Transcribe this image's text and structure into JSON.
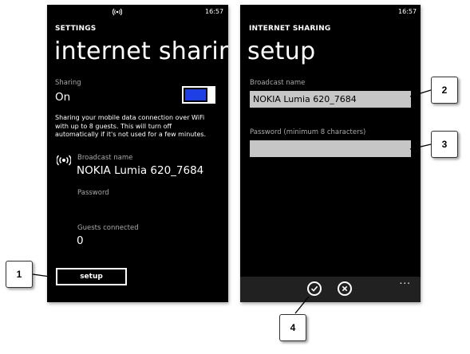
{
  "left_screen": {
    "status_time": "16:57",
    "app_title": "SETTINGS",
    "page_title": "internet sharing",
    "sharing_label": "Sharing",
    "sharing_value": "On",
    "toggle_on": true,
    "description": "Sharing your mobile data connection over WiFi with up to 8 guests. This will turn off automatically if it's not used for a few minutes.",
    "broadcast_label": "Broadcast name",
    "broadcast_value": "NOKIA Lumia 620_7684",
    "password_label": "Password",
    "guests_label": "Guests connected",
    "guests_value": "0",
    "setup_button": "setup"
  },
  "right_screen": {
    "status_time": "16:57",
    "app_title": "INTERNET SHARING",
    "page_title": "setup",
    "broadcast_label": "Broadcast name",
    "broadcast_value": "NOKIA Lumia 620_7684",
    "password_label": "Password (minimum 8 characters)",
    "password_value": "",
    "appbar_more": "..."
  },
  "callouts": [
    "1",
    "2",
    "3",
    "4"
  ],
  "colors": {
    "accent": "#1f3fe6",
    "textbox": "#c6c6c6",
    "appbar": "#212121",
    "label_gray": "#a8a8a8"
  }
}
